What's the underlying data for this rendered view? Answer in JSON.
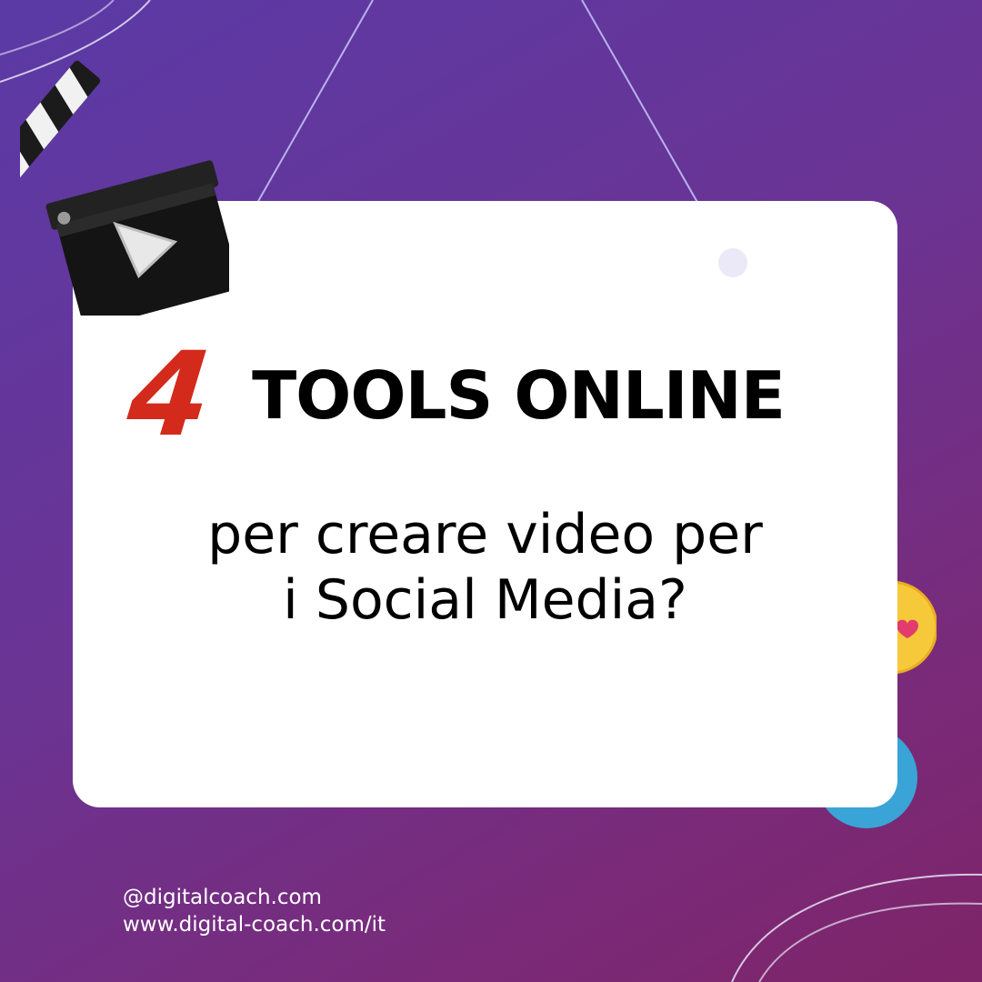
{
  "headline": {
    "number": "4",
    "title": "TOOLS ONLINE"
  },
  "subtitle": {
    "line1": "per creare video per",
    "line2": "i Social Media?"
  },
  "footer": {
    "handle": "@digitalcoach.com",
    "website": "www.digital-coach.com/it"
  },
  "icons": {
    "clapperboard": "clapperboard-icon",
    "play": "play-icon",
    "heart_emoji": "heart-eyes-emoji-icon"
  },
  "colors": {
    "background_start": "#5b3aa6",
    "background_end": "#7e2468",
    "card": "#ffffff",
    "number_accent": "#d32a1c",
    "bubble": "#3aa4d6",
    "emoji_yellow": "#f6c93a"
  }
}
